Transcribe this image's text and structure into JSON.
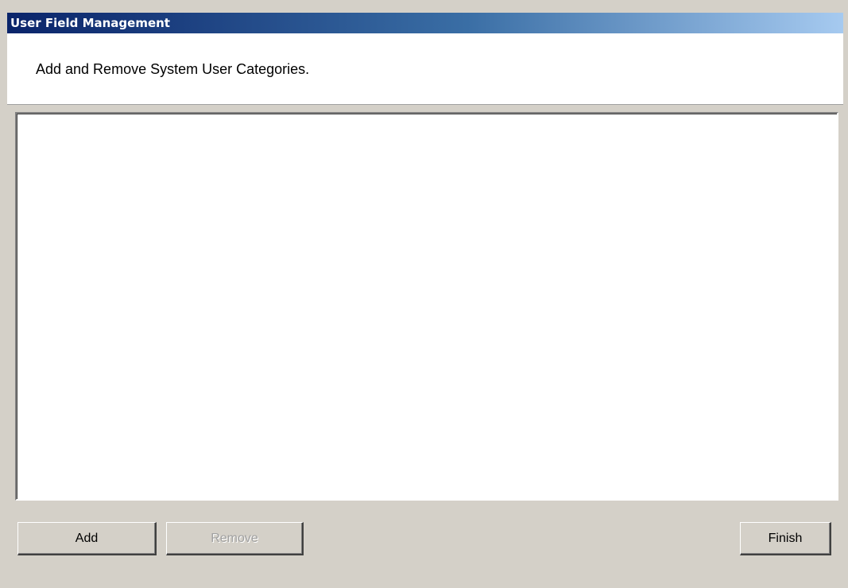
{
  "window": {
    "title": "User Field Management"
  },
  "header": {
    "description": "Add and Remove System User Categories."
  },
  "category_list": {
    "items": []
  },
  "buttons": {
    "add_label": "Add",
    "remove_label": "Remove",
    "remove_enabled": false,
    "finish_label": "Finish"
  },
  "colors": {
    "titlebar_start": "#0a246a",
    "titlebar_end": "#a6caf0",
    "dialog_background": "#d4d0c8",
    "panel_background": "#ffffff"
  }
}
